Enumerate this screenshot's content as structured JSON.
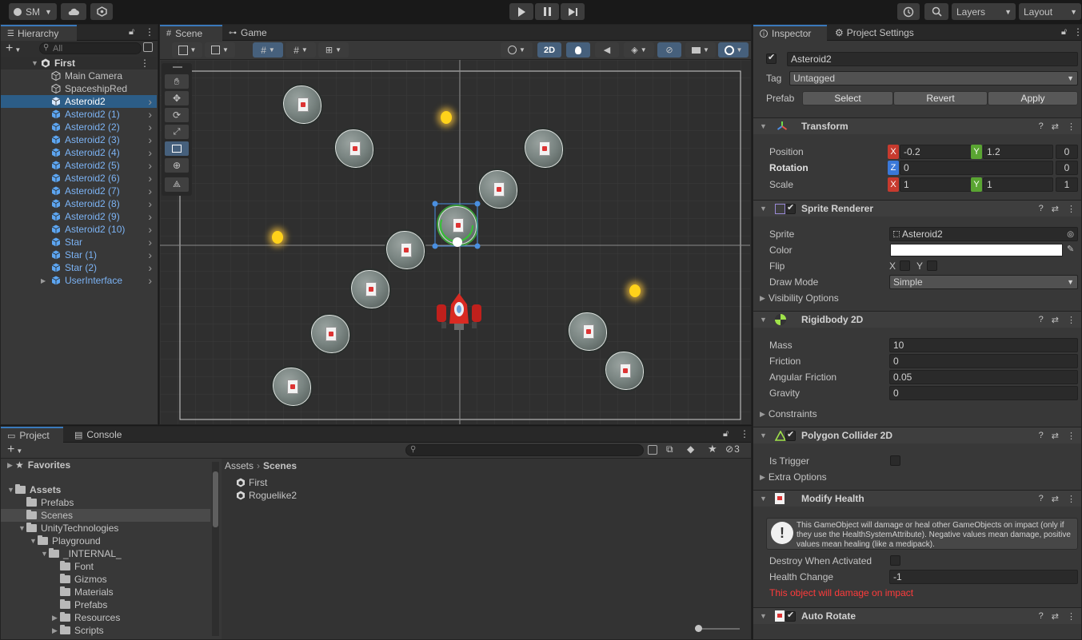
{
  "toolbar": {
    "account": "SM",
    "layers": "Layers",
    "layout": "Layout"
  },
  "hierarchy": {
    "tab": "Hierarchy",
    "search_placeholder": "All",
    "scene": "First",
    "items": [
      {
        "label": "Main Camera",
        "type": "object"
      },
      {
        "label": "SpaceshipRed",
        "type": "object"
      },
      {
        "label": "Asteroid2",
        "type": "prefab",
        "selected": true
      },
      {
        "label": "Asteroid2 (1)",
        "type": "prefab"
      },
      {
        "label": "Asteroid2 (2)",
        "type": "prefab"
      },
      {
        "label": "Asteroid2 (3)",
        "type": "prefab"
      },
      {
        "label": "Asteroid2 (4)",
        "type": "prefab"
      },
      {
        "label": "Asteroid2 (5)",
        "type": "prefab"
      },
      {
        "label": "Asteroid2 (6)",
        "type": "prefab"
      },
      {
        "label": "Asteroid2 (7)",
        "type": "prefab"
      },
      {
        "label": "Asteroid2 (8)",
        "type": "prefab"
      },
      {
        "label": "Asteroid2 (9)",
        "type": "prefab"
      },
      {
        "label": "Asteroid2 (10)",
        "type": "prefab"
      },
      {
        "label": "Star",
        "type": "prefab"
      },
      {
        "label": "Star (1)",
        "type": "prefab"
      },
      {
        "label": "Star (2)",
        "type": "prefab"
      },
      {
        "label": "UserInterface",
        "type": "prefab"
      }
    ]
  },
  "scene": {
    "tab_scene": "Scene",
    "tab_game": "Game",
    "mode_2d": "2D"
  },
  "inspector": {
    "tab": "Inspector",
    "tab_settings": "Project Settings",
    "object_name": "Asteroid2",
    "tag_label": "Tag",
    "tag_value": "Untagged",
    "prefab_label": "Prefab",
    "prefab_select": "Select",
    "prefab_revert": "Revert",
    "prefab_apply": "Apply",
    "transform": {
      "title": "Transform",
      "position_label": "Position",
      "rotation_label": "Rotation",
      "scale_label": "Scale",
      "pos_x": "-0.2",
      "pos_y": "1.2",
      "pos_z": "0",
      "rot_z": "0",
      "rot_extra": "0",
      "scale_x": "1",
      "scale_y": "1",
      "scale_z": "1",
      "x": "X",
      "y": "Y",
      "z": "Z"
    },
    "sprite_renderer": {
      "title": "Sprite Renderer",
      "sprite_label": "Sprite",
      "sprite_value": "Asteroid2",
      "color_label": "Color",
      "flip_label": "Flip",
      "flip_x": "X",
      "flip_y": "Y",
      "draw_mode_label": "Draw Mode",
      "draw_mode_value": "Simple",
      "visibility": "Visibility Options"
    },
    "rigidbody": {
      "title": "Rigidbody 2D",
      "mass_label": "Mass",
      "mass": "10",
      "friction_label": "Friction",
      "friction": "0",
      "angular_label": "Angular Friction",
      "angular": "0.05",
      "gravity_label": "Gravity",
      "gravity": "0",
      "constraints": "Constraints"
    },
    "collider": {
      "title": "Polygon Collider 2D",
      "trigger_label": "Is Trigger",
      "extra": "Extra Options"
    },
    "modify_health": {
      "title": "Modify Health",
      "help": "This GameObject will damage or heal other GameObjects on impact (only if they use the HealthSystemAttribute). Negative values mean damage, positive values mean healing (like a medipack).",
      "destroy_label": "Destroy When Activated",
      "change_label": "Health Change",
      "change_value": "-1",
      "warning": "This object will damage on impact"
    },
    "auto_rotate": {
      "title": "Auto Rotate"
    }
  },
  "project": {
    "tab": "Project",
    "tab_console": "Console",
    "hidden_count": "3",
    "favorites": "Favorites",
    "tree": [
      {
        "label": "Assets",
        "depth": 0,
        "bold": true
      },
      {
        "label": "Prefabs",
        "depth": 1
      },
      {
        "label": "Scenes",
        "depth": 1,
        "selected": true
      },
      {
        "label": "UnityTechnologies",
        "depth": 1,
        "open": true
      },
      {
        "label": "Playground",
        "depth": 2,
        "open": true
      },
      {
        "label": "_INTERNAL_",
        "depth": 3,
        "open": true
      },
      {
        "label": "Font",
        "depth": 4
      },
      {
        "label": "Gizmos",
        "depth": 4
      },
      {
        "label": "Materials",
        "depth": 4
      },
      {
        "label": "Prefabs",
        "depth": 4
      },
      {
        "label": "Resources",
        "depth": 4,
        "collapsed": true
      },
      {
        "label": "Scripts",
        "depth": 4,
        "collapsed": true
      }
    ],
    "breadcrumb_root": "Assets",
    "breadcrumb_current": "Scenes",
    "files": [
      "First",
      "Roguelike2"
    ]
  },
  "colors": {
    "accent": "#3a79bb",
    "selection": "#2c5d87",
    "prefab_text": "#7cb3f4",
    "warning": "#ff3b3b"
  }
}
